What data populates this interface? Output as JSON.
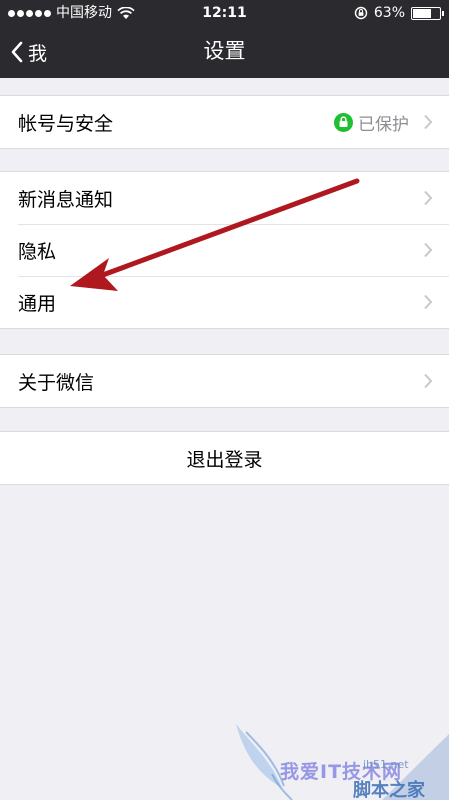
{
  "status_bar": {
    "carrier": "中国移动",
    "time": "12:11",
    "battery_percent": "63%",
    "battery_level": 0.63
  },
  "nav": {
    "back_label": "我",
    "title": "设置"
  },
  "account_group": {
    "account_security": {
      "label": "帐号与安全",
      "status": "已保护",
      "status_icon": "lock-icon",
      "status_color": "#1fbf32"
    }
  },
  "settings_group": {
    "items": [
      {
        "label": "新消息通知"
      },
      {
        "label": "隐私"
      },
      {
        "label": "通用"
      }
    ]
  },
  "about_group": {
    "about": {
      "label": "关于微信"
    }
  },
  "logout": {
    "label": "退出登录"
  },
  "annotation": {
    "type": "arrow",
    "color": "#b01820",
    "points_to": "通用"
  },
  "watermark": {
    "line1": "我爱IT技术网",
    "line2": "脚本之家",
    "url": "jb51.net"
  },
  "colors": {
    "nav_background": "#2b2b2f",
    "page_background": "#efeff4",
    "chevron": "#c7c7cc"
  }
}
